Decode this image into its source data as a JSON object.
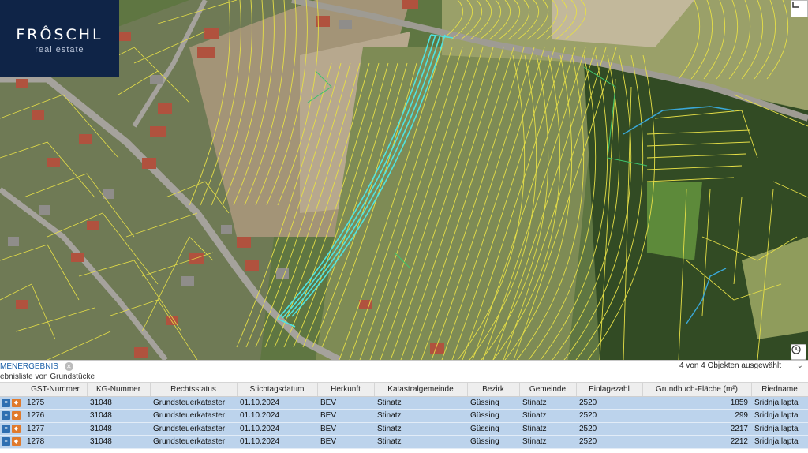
{
  "logo": {
    "brand": "FRÔSCHL",
    "sub": "real estate"
  },
  "map": {
    "icons": {
      "corner": "expand-icon",
      "clock": "clock-icon"
    },
    "colors": {
      "parcel_line": "#e8e14a",
      "selected_parcel": "#4fe3e0",
      "creek": "#3aa8d8",
      "field": "#7d8a52",
      "forest": "#2f4a22",
      "road": "#9a9a96"
    }
  },
  "panel": {
    "title": "MENERGEBNIS",
    "subtitle": "ebnisliste von Grundstücke",
    "count_text": "4 von 4 Objekten ausgewählt",
    "columns": [
      "GST-Nummer",
      "KG-Nummer",
      "Rechtsstatus",
      "Stichtagsdatum",
      "Herkunft",
      "Katastralgemeinde",
      "Bezirk",
      "Gemeinde",
      "Einlagezahl",
      "Grundbuch-Fläche (m²)",
      "Riedname"
    ],
    "rows": [
      [
        "1275",
        "31048",
        "Grundsteuerkataster",
        "01.10.2024",
        "BEV",
        "Stinatz",
        "Güssing",
        "Stinatz",
        "2520",
        "1859",
        "Sridnja lapta"
      ],
      [
        "1276",
        "31048",
        "Grundsteuerkataster",
        "01.10.2024",
        "BEV",
        "Stinatz",
        "Güssing",
        "Stinatz",
        "2520",
        "299",
        "Sridnja lapta"
      ],
      [
        "1277",
        "31048",
        "Grundsteuerkataster",
        "01.10.2024",
        "BEV",
        "Stinatz",
        "Güssing",
        "Stinatz",
        "2520",
        "2217",
        "Sridnja lapta"
      ],
      [
        "1278",
        "31048",
        "Grundsteuerkataster",
        "01.10.2024",
        "BEV",
        "Stinatz",
        "Güssing",
        "Stinatz",
        "2520",
        "2212",
        "Sridnja lapta"
      ]
    ]
  }
}
